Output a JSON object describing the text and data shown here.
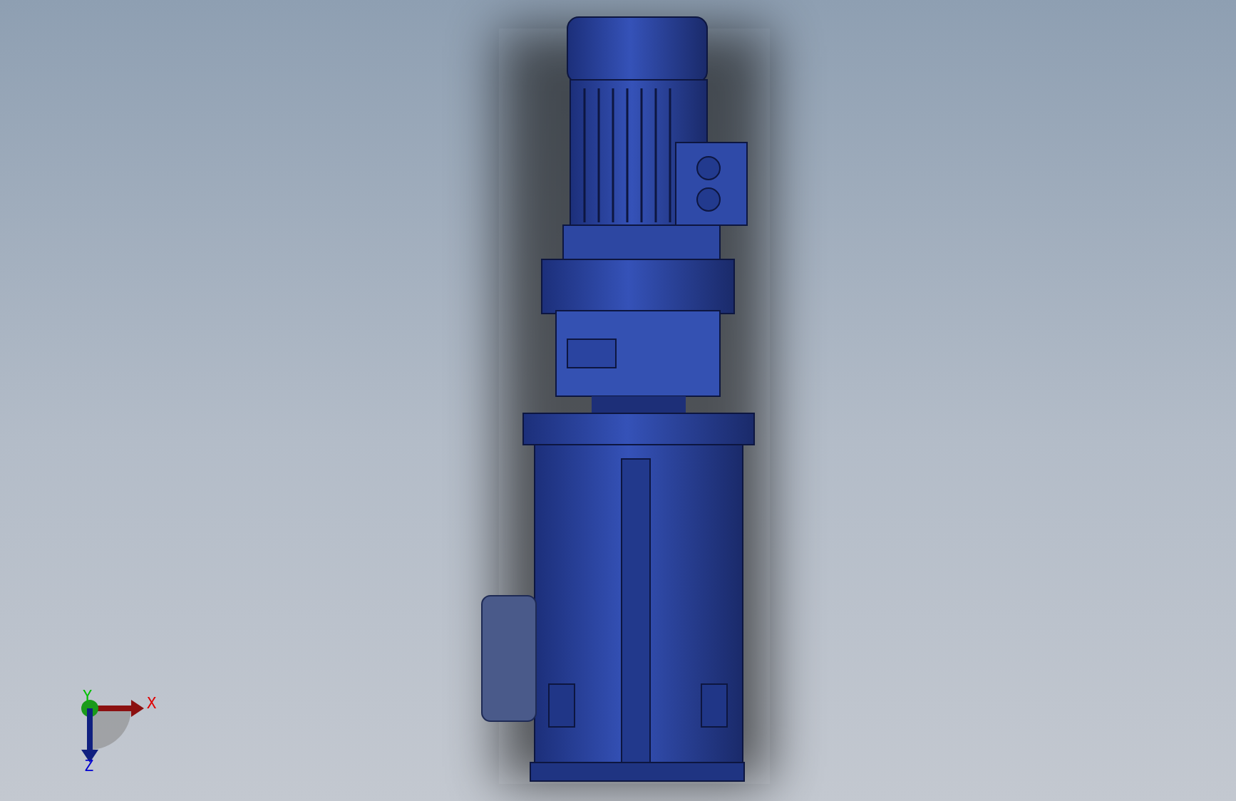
{
  "triad": {
    "axes": [
      {
        "kind": "x",
        "label": "X",
        "color": "#e00000"
      },
      {
        "kind": "y",
        "label": "Y",
        "color": "#00c000"
      },
      {
        "kind": "z",
        "label": "Z",
        "color": "#0000d0"
      }
    ]
  }
}
